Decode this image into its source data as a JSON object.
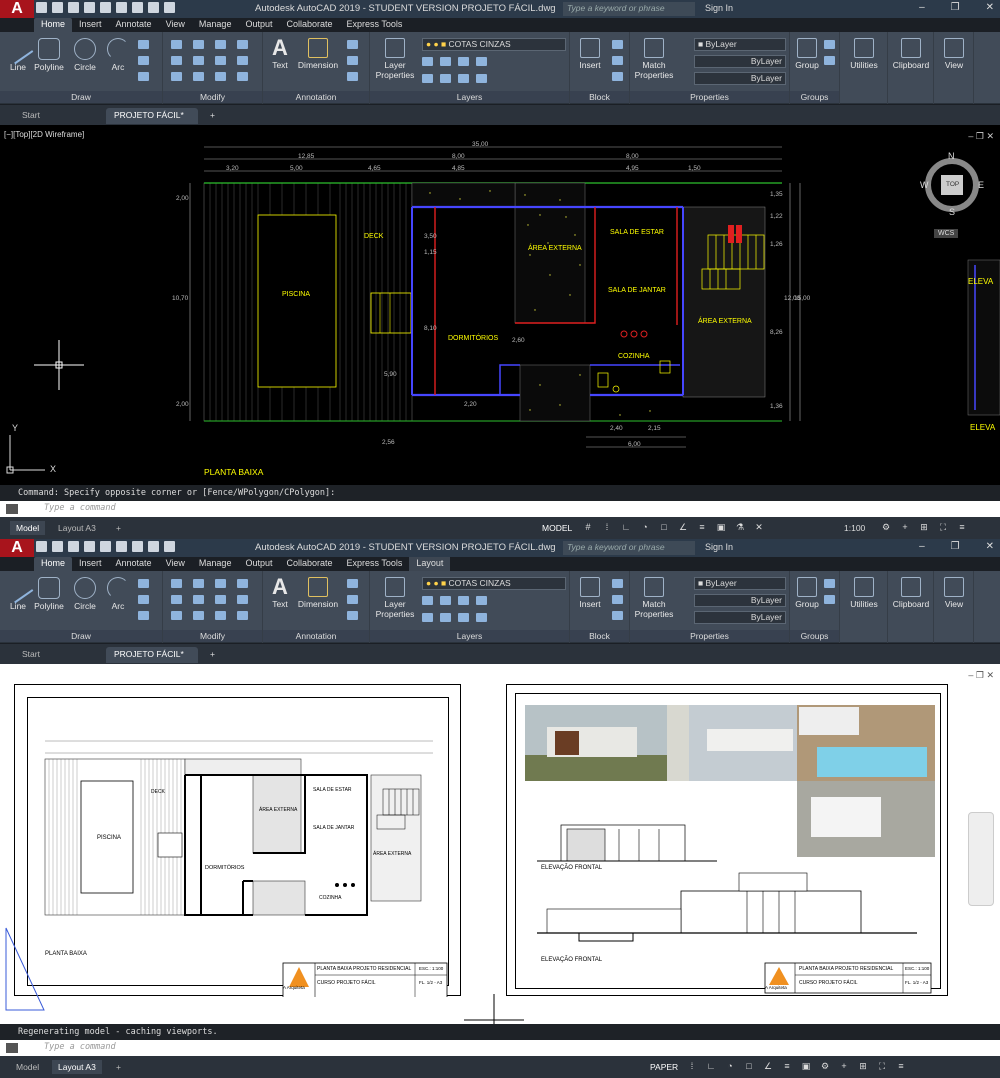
{
  "top": {
    "app_title": "Autodesk AutoCAD 2019 - STUDENT VERSION    PROJETO FÁCIL.dwg",
    "search_placeholder": "Type a keyword or phrase",
    "signin": "Sign In",
    "ribbon_tabs": [
      "Home",
      "Insert",
      "Annotate",
      "View",
      "Manage",
      "Output",
      "Collaborate",
      "Express Tools"
    ],
    "draw_tools": [
      "Line",
      "Polyline",
      "Circle",
      "Arc"
    ],
    "panels": {
      "draw": "Draw",
      "modify": "Modify",
      "annotation": "Annotation",
      "layers": "Layers",
      "block": "Block",
      "properties": "Properties",
      "groups": "Groups"
    },
    "text_tool": "Text",
    "dimension_tool": "Dimension",
    "layer_properties": "Layer Properties",
    "layer_current": "COTAS CINZAS",
    "insert": "Insert",
    "match_properties": "Match Properties",
    "bylayer": [
      "ByLayer",
      "ByLayer",
      "ByLayer"
    ],
    "group": "Group",
    "utilities": "Utilities",
    "clipboard": "Clipboard",
    "view": "View",
    "doc_tabs": [
      "Start",
      "PROJETO FÁCIL*"
    ],
    "viewport_label": "[−][Top][2D Wireframe]",
    "viewcube": {
      "n": "N",
      "s": "S",
      "e": "E",
      "w": "W",
      "top": "TOP",
      "wcs": "WCS"
    },
    "plan_title": "PLANTA BAIXA",
    "rooms": [
      "DECK",
      "PISCINA",
      "ÁREA EXTERNA",
      "SALA DE ESTAR",
      "SALA DE JANTAR",
      "DORMITÓRIOS",
      "COZINHA",
      "ÁREA EXTERNA",
      "ELEVA",
      "ELEVA"
    ],
    "dims_top": [
      "35,00",
      "12,85",
      "8,00",
      "8,00",
      "3,20",
      "5,00",
      "4,65",
      "4,85",
      "4,95",
      "1,50"
    ],
    "dims_side": [
      "2,00",
      "10,70",
      "2,00",
      "3,50",
      "1,15",
      "8,10",
      "5,90",
      "2,20",
      "2,60",
      "12,00",
      "15,00",
      "8,26",
      "1,22",
      "1,35",
      "1,26",
      "1,36"
    ],
    "dims_bottom": [
      "2,56",
      "2,40",
      "2,15",
      "6,00"
    ],
    "command_history": "Command: Specify opposite corner or [Fence/WPolygon/CPolygon]:",
    "command_placeholder": "Type a command",
    "status_tabs": [
      "Model",
      "Layout A3"
    ],
    "status_model": "MODEL",
    "scale": "1:100"
  },
  "bottom": {
    "app_title": "Autodesk AutoCAD 2019 - STUDENT VERSION    PROJETO FÁCIL.dwg",
    "search_placeholder": "Type a keyword or phrase",
    "signin": "Sign In",
    "ribbon_tabs": [
      "Home",
      "Insert",
      "Annotate",
      "View",
      "Manage",
      "Output",
      "Collaborate",
      "Express Tools",
      "Layout"
    ],
    "draw_tools": [
      "Line",
      "Polyline",
      "Circle",
      "Arc"
    ],
    "panels": {
      "draw": "Draw",
      "modify": "Modify",
      "annotation": "Annotation",
      "layers": "Layers",
      "block": "Block",
      "properties": "Properties",
      "groups": "Groups"
    },
    "text_tool": "Text",
    "dimension_tool": "Dimension",
    "layer_properties": "Layer Properties",
    "layer_current": "COTAS CINZAS",
    "insert": "Insert",
    "match_properties": "Match Properties",
    "bylayer": [
      "ByLayer",
      "ByLayer",
      "ByLayer"
    ],
    "group": "Group",
    "utilities": "Utilities",
    "clipboard": "Clipboard",
    "view": "View",
    "doc_tabs": [
      "Start",
      "PROJETO FÁCIL*"
    ],
    "sheet1": {
      "title": "PLANTA BAIXA",
      "rooms": [
        "PISCINA",
        "DECK",
        "DORMITÓRIOS",
        "ÁREA EXTERNA",
        "SALA DE ESTAR",
        "SALA DE JANTAR",
        "ÁREA EXTERNA",
        "COZINHA"
      ]
    },
    "sheet2": {
      "title": "ELEVAÇÃO FRONTAL",
      "title2": "ELEVAÇÃO FRONTAL"
    },
    "title_block_1": {
      "brand": "A Arquiteta",
      "name": "PLANTA BAIXA PROJETO RESIDENCIAL",
      "course": "CURSO PROJETO FÁCIL",
      "esc": "ESC.: 1:100",
      "fl": "FL. 1/2 - A3"
    },
    "title_block_2": {
      "brand": "A Arquiteta",
      "name": "PLANTA BAIXA PROJETO RESIDENCIAL",
      "course": "CURSO PROJETO FÁCIL",
      "esc": "ESC.: 1:100",
      "fl": "FL. 1/2 - A3"
    },
    "command_history": "Regenerating model - caching viewports.",
    "command_placeholder": "Type a command",
    "status_tabs": [
      "Model",
      "Layout A3"
    ],
    "status_paper": "PAPER"
  }
}
